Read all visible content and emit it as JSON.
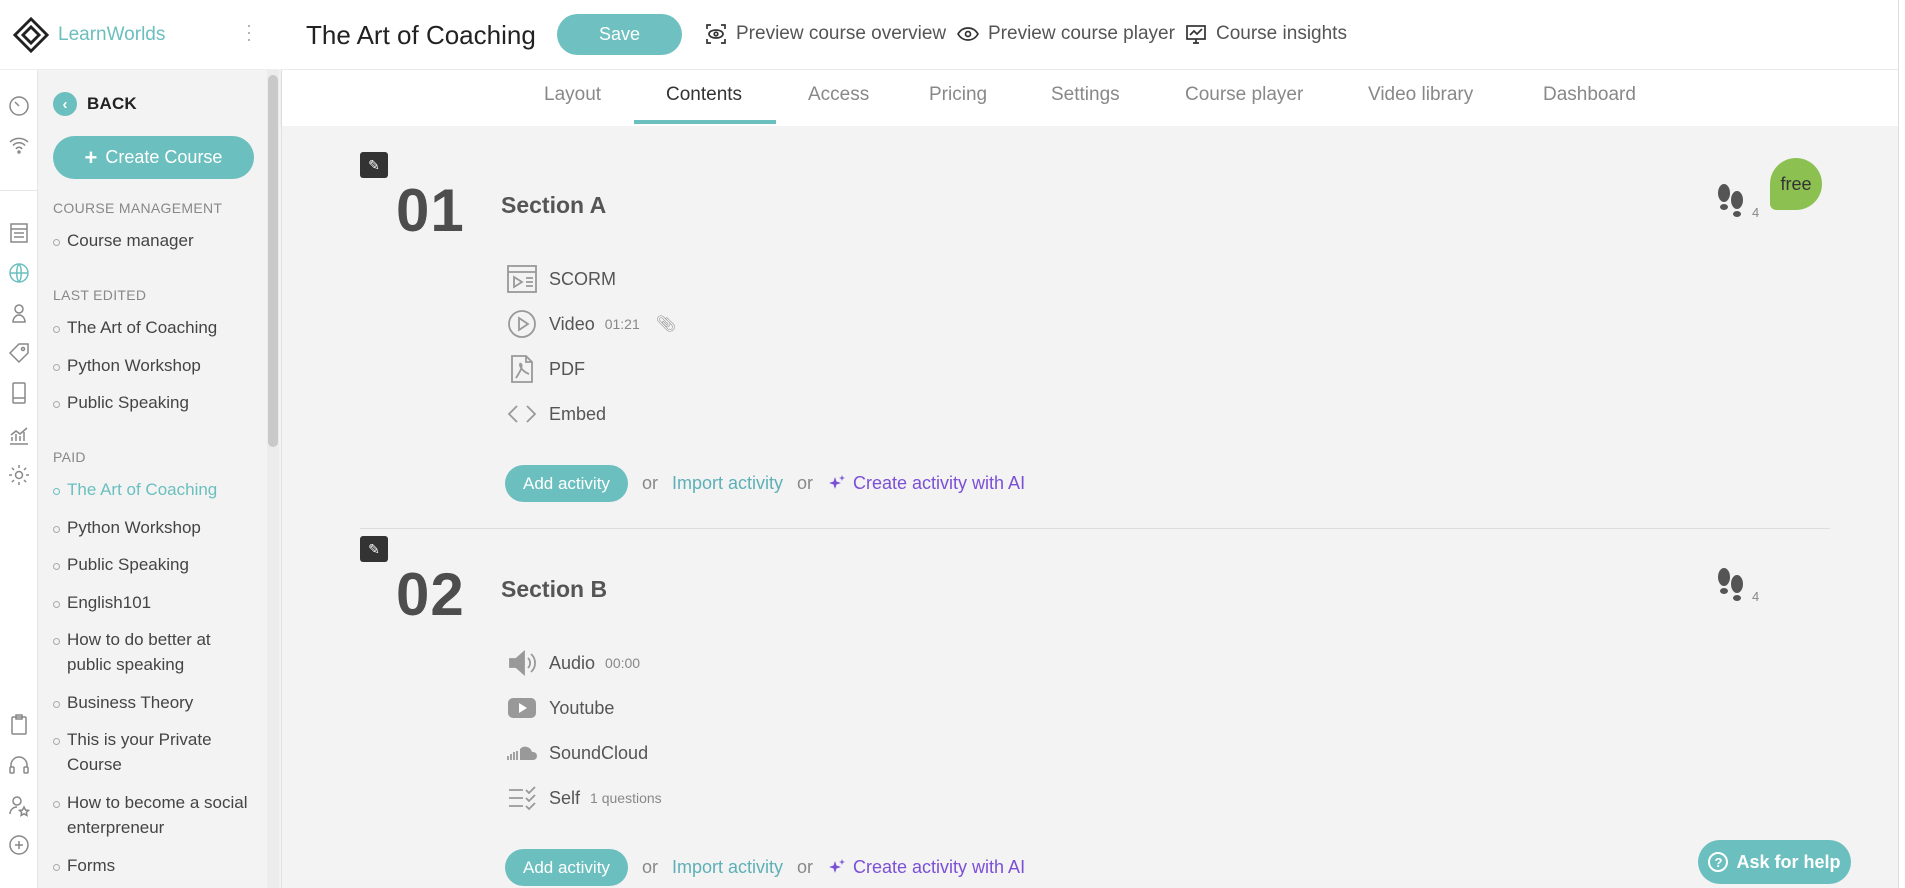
{
  "brand": {
    "name": "LearnWorlds"
  },
  "sidebar": {
    "back_label": "BACK",
    "create_label": "Create Course",
    "groups": [
      {
        "title": "COURSE MANAGEMENT",
        "items": [
          "Course manager"
        ]
      },
      {
        "title": "LAST EDITED",
        "items": [
          "The Art of Coaching",
          "Python Workshop",
          "Public Speaking"
        ]
      },
      {
        "title": "PAID",
        "items": [
          "The Art of Coaching",
          "Python Workshop",
          "Public Speaking",
          "English101",
          "How to do better at public speaking",
          "Business Theory",
          "This is your Private Course",
          "How to become a social enterpreneur",
          "Forms"
        ]
      }
    ],
    "active_item": "The Art of Coaching"
  },
  "header": {
    "title": "The Art of Coaching",
    "save_label": "Save",
    "links": [
      "Preview course overview",
      "Preview course player",
      "Course insights"
    ]
  },
  "tabs": [
    "Layout",
    "Contents",
    "Access",
    "Pricing",
    "Settings",
    "Course player",
    "Video library",
    "Dashboard"
  ],
  "active_tab": "Contents",
  "sections": [
    {
      "number": "01",
      "title": "Section A",
      "steps": "4",
      "badge": "free",
      "activities": [
        {
          "icon": "scorm-icon",
          "label": "SCORM",
          "meta": ""
        },
        {
          "icon": "play-icon",
          "label": "Video",
          "meta": "01:21"
        },
        {
          "icon": "pdf-icon",
          "label": "PDF",
          "meta": ""
        },
        {
          "icon": "embed-icon",
          "label": "Embed",
          "meta": ""
        }
      ]
    },
    {
      "number": "02",
      "title": "Section B",
      "steps": "4",
      "badge": "",
      "activities": [
        {
          "icon": "speaker-icon",
          "label": "Audio",
          "meta": "00:00"
        },
        {
          "icon": "youtube-icon",
          "label": "Youtube",
          "meta": ""
        },
        {
          "icon": "soundcloud-icon",
          "label": "SoundCloud",
          "meta": ""
        },
        {
          "icon": "checklist-icon",
          "label": "Self",
          "meta": "1 questions"
        }
      ]
    }
  ],
  "actions": {
    "add_label": "Add activity",
    "or_label": "or",
    "import_label": "Import activity",
    "ai_label": "Create activity with AI"
  },
  "help": {
    "label": "Ask for help"
  },
  "colors": {
    "accent": "#6bbfbf",
    "ai": "#7b4fd6",
    "free_badge": "#8cc152"
  }
}
